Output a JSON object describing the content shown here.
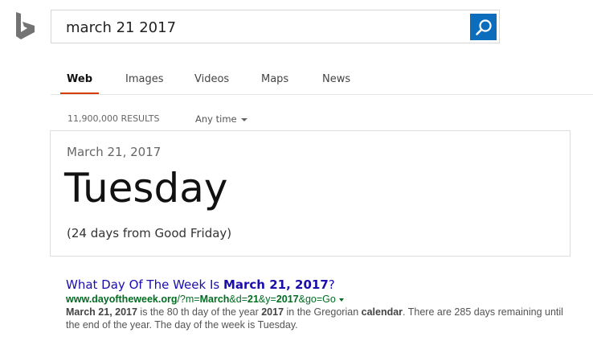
{
  "search": {
    "query": "march 21 2017",
    "button_icon": "search-icon"
  },
  "tabs": [
    {
      "label": "Web",
      "active": true
    },
    {
      "label": "Images",
      "active": false
    },
    {
      "label": "Videos",
      "active": false
    },
    {
      "label": "Maps",
      "active": false
    },
    {
      "label": "News",
      "active": false
    }
  ],
  "results_bar": {
    "count": "11,900,000 RESULTS",
    "time_filter": "Any time"
  },
  "answer": {
    "date": "March 21, 2017",
    "day": "Tuesday",
    "note": "(24 days from Good Friday)"
  },
  "result": {
    "title_prefix": "What Day Of The Week Is ",
    "title_bold": "March 21, 2017",
    "title_suffix": "?",
    "url_domain": "www.dayoftheweek.org",
    "url_path_1": "/?m=",
    "url_bold_1": "March",
    "url_path_2": "&d=",
    "url_bold_2": "21",
    "url_path_3": "&y=",
    "url_bold_3": "2017",
    "url_path_4": "&go=Go",
    "snippet_bold_1": "March 21, 2017",
    "snippet_text_1": " is the 80 th day of the year ",
    "snippet_bold_2": "2017",
    "snippet_text_2": " in the Gregorian ",
    "snippet_bold_3": "calendar",
    "snippet_text_3": ". There are 285 days remaining until the end of the year. The day of the week is Tuesday."
  },
  "colors": {
    "brand_logo": "#737373",
    "search_button": "#0c6dbd",
    "active_tab_underline": "#d63b00",
    "link": "#1a0dab",
    "url": "#006d21"
  }
}
